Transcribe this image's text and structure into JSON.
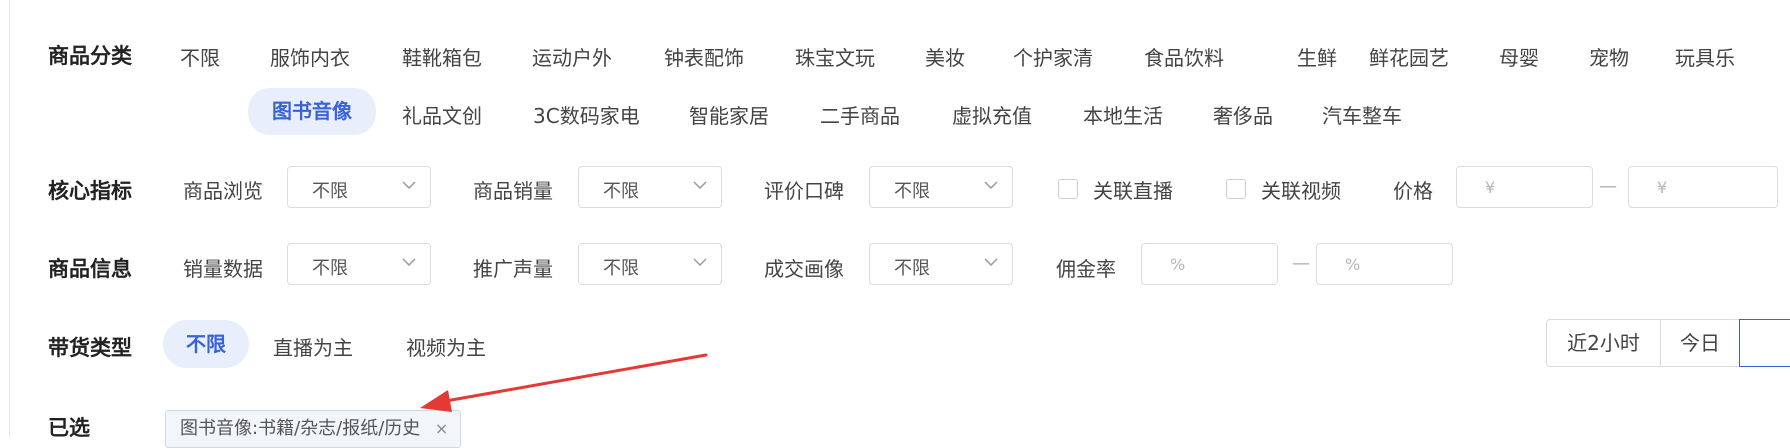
{
  "category": {
    "label": "商品分类",
    "row1": [
      "不限",
      "服饰内衣",
      "鞋靴箱包",
      "运动户外",
      "钟表配饰",
      "珠宝文玩",
      "美妆",
      "个护家清",
      "食品饮料",
      "生鲜",
      "鲜花园艺",
      "母婴",
      "宠物",
      "玩具乐"
    ],
    "row2": [
      "图书音像",
      "礼品文创",
      "3C数码家电",
      "智能家居",
      "二手商品",
      "虚拟充值",
      "本地生活",
      "奢侈品",
      "汽车整车"
    ],
    "active": "图书音像"
  },
  "core": {
    "label": "核心指标",
    "browse_label": "商品浏览",
    "browse_value": "不限",
    "sales_label": "商品销量",
    "sales_value": "不限",
    "review_label": "评价口碑",
    "review_value": "不限",
    "live_label": "关联直播",
    "video_label": "关联视频",
    "price_label": "价格",
    "price_min_placeholder": "¥",
    "price_max_placeholder": "¥",
    "range_sep": "—"
  },
  "info": {
    "label": "商品信息",
    "salesdata_label": "销量数据",
    "salesdata_value": "不限",
    "promo_label": "推广声量",
    "promo_value": "不限",
    "portrait_label": "成交画像",
    "portrait_value": "不限",
    "commission_label": "佣金率",
    "commission_min_placeholder": "%",
    "commission_max_placeholder": "%",
    "range_sep": "—"
  },
  "sell_type": {
    "label": "带货类型",
    "options": [
      "不限",
      "直播为主",
      "视频为主"
    ],
    "active": "不限"
  },
  "time_segments": [
    "近2小时",
    "今日"
  ],
  "selected": {
    "label": "已选",
    "tag": "图书音像:书籍/杂志/报纸/历史",
    "remove_symbol": "×"
  },
  "colors": {
    "accent": "#3a63d6",
    "accent_bg": "#e8eefc",
    "arrow": "#e53935"
  }
}
